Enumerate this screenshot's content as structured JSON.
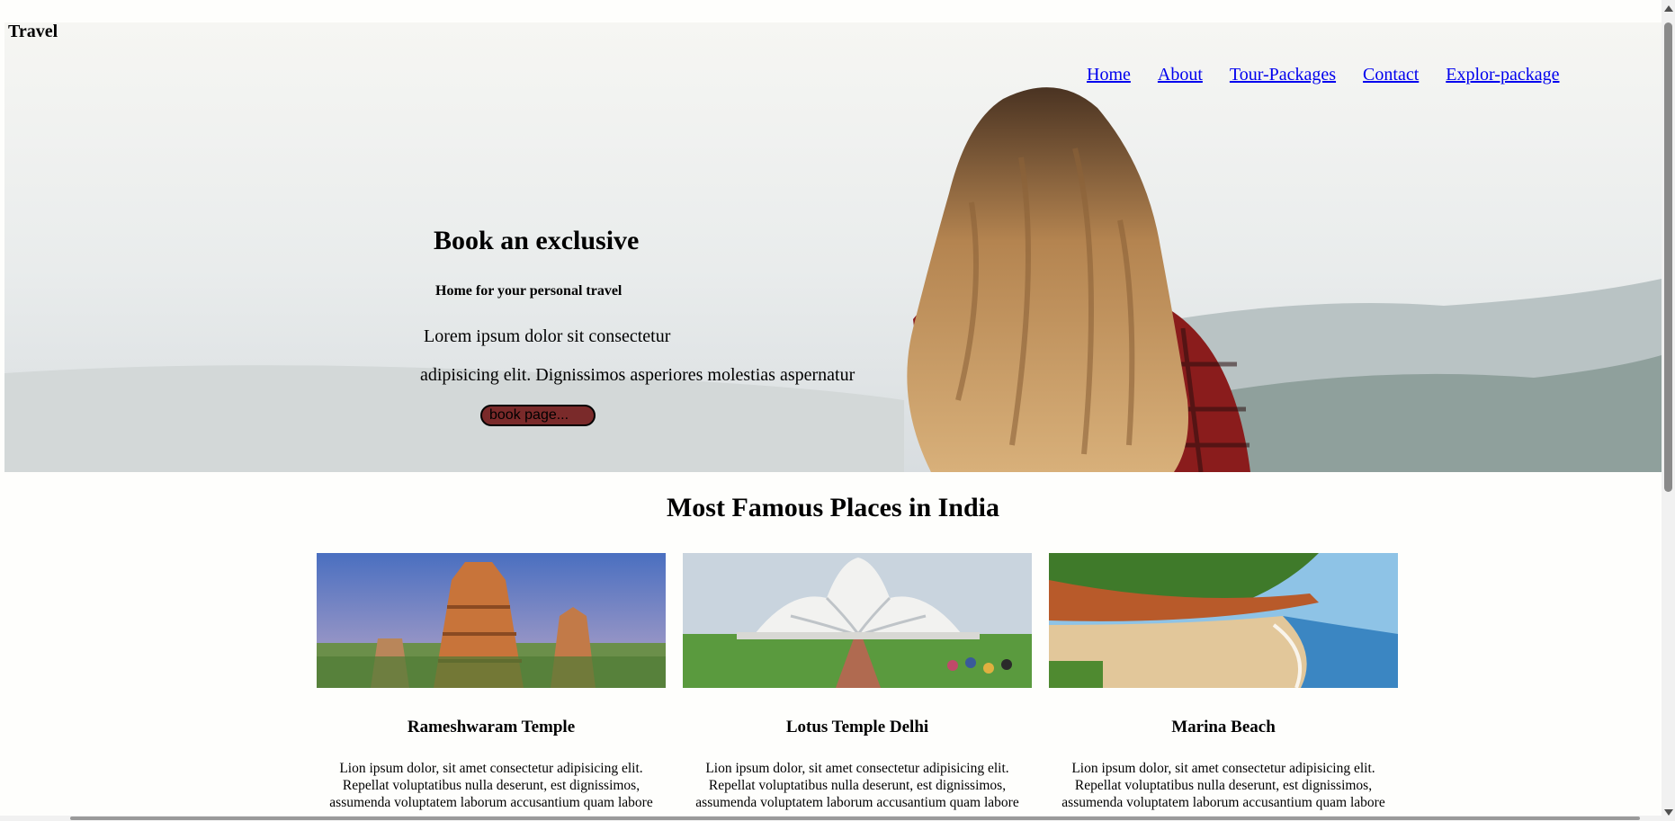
{
  "brand": "Travel",
  "nav": {
    "items": [
      {
        "label": "Home",
        "name": "nav-link-home"
      },
      {
        "label": "About",
        "name": "nav-link-about"
      },
      {
        "label": "Tour-Packages",
        "name": "nav-link-tour-packages"
      },
      {
        "label": "Contact",
        "name": "nav-link-contact"
      },
      {
        "label": "Explor-package",
        "name": "nav-link-explor-package"
      }
    ]
  },
  "hero": {
    "title": "Book an exclusive",
    "subtitle": "Home for your personal travel",
    "paragraph_line1": "Lorem ipsum dolor sit consectetur",
    "paragraph_line2": "adipisicing elit. Dignissimos asperiores molestias aspernatur",
    "button_label": "book page..."
  },
  "places": {
    "heading": "Most Famous Places in India",
    "cards": [
      {
        "title": "Rameshwaram Temple",
        "description": "Lion ipsum dolor, sit amet consectetur adipisicing elit. Repellat voluptatibus nulla deserunt, est dignissimos, assumenda voluptatem laborum accusantium quam labore"
      },
      {
        "title": "Lotus Temple Delhi",
        "description": "Lion ipsum dolor, sit amet consectetur adipisicing elit. Repellat voluptatibus nulla deserunt, est dignissimos, assumenda voluptatem laborum accusantium quam labore"
      },
      {
        "title": "Marina Beach",
        "description": "Lion ipsum dolor, sit amet consectetur adipisicing elit. Repellat voluptatibus nulla deserunt, est dignissimos, assumenda voluptatem laborum accusantium quam labore"
      }
    ]
  },
  "colors": {
    "page_background": "#fefefc",
    "link": "#0000ee",
    "button_background": "#7a2a2a"
  }
}
